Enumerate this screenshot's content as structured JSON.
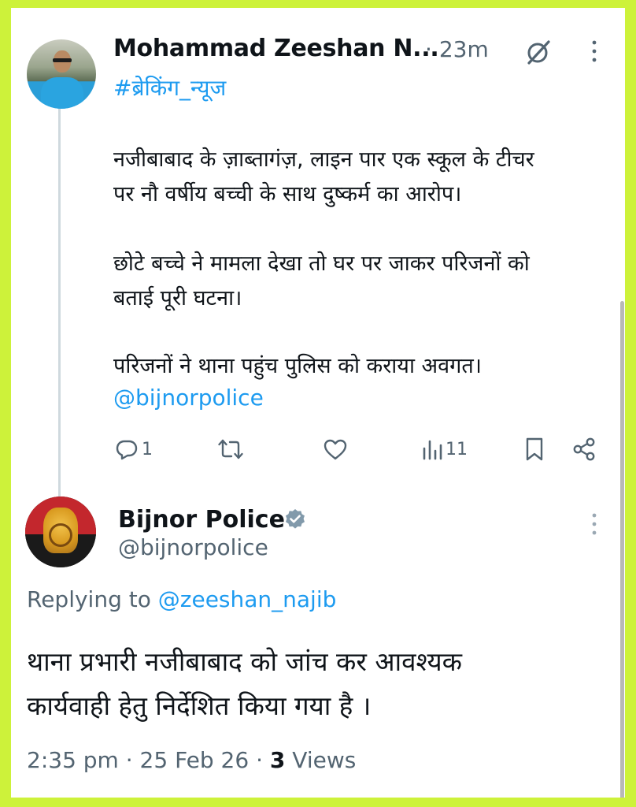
{
  "tweet": {
    "author_name": "Mohammad Zeeshan N...",
    "separator": "·",
    "time_ago": "23m",
    "hashtag": "#ब्रेकिंग_न्यूज",
    "lines": [
      "नजीबाबाद के ज़ाब्तागंज़, लाइन पार एक स्कूल के टीचर",
      "पर नौ वर्षीय बच्ची के साथ दुष्कर्म का आरोप।",
      "छोटे बच्चे ने मामला देखा तो घर पर जाकर परिजनों को",
      "बताई पूरी घटना।",
      "परिजनों ने थाना पहुंच पुलिस को कराया अवगत।"
    ],
    "mention": "@bijnorpolice",
    "actions": {
      "reply_count": "1",
      "views_count": "11"
    }
  },
  "reply": {
    "author_name": "Bijnor Police",
    "handle": "@bijnorpolice",
    "replying_prefix": "Replying to ",
    "replying_handle": "@zeeshan_najib",
    "lines": [
      "थाना प्रभारी नजीबाबाद को जांच कर आवश्यक",
      "कार्यवाही हेतु निर्देशित किया गया है ।"
    ],
    "time": "2:35 pm",
    "date": "25 Feb 26",
    "views_count": "3",
    "views_label": "Views"
  },
  "colors": {
    "border": "#cdf23a",
    "link": "#1d9bf0",
    "secondary_text": "#536471",
    "verified": "#829aab"
  },
  "icons": [
    "grok-icon",
    "more-icon",
    "reply-icon",
    "retweet-icon",
    "like-icon",
    "views-icon",
    "bookmark-icon",
    "share-icon",
    "verified-icon"
  ]
}
